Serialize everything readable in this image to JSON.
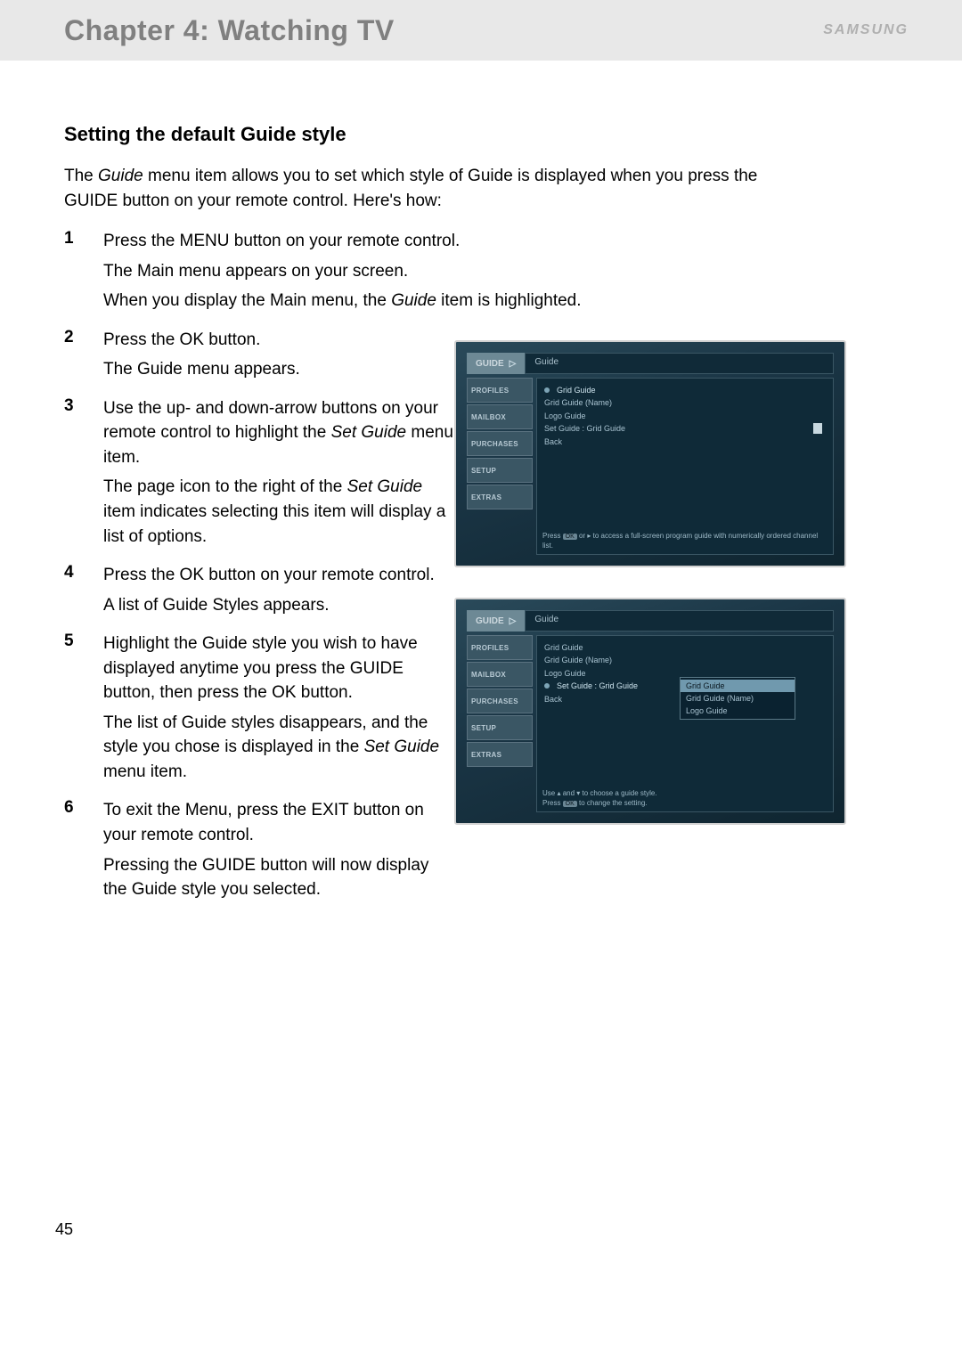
{
  "header": {
    "chapter_title": "Chapter 4: Watching TV",
    "brand": "SAMSUNG"
  },
  "section": {
    "title": "Setting the default Guide style",
    "intro_a": "The ",
    "intro_guide": "Guide",
    "intro_b": " menu item allows you to set which style of Guide is displayed when you press the GUIDE button on your remote control. Here's how:"
  },
  "steps": {
    "s1": {
      "num": "1",
      "p1": "Press the MENU button on your remote control.",
      "p2": "The Main menu appears on your screen.",
      "p3a": "When you display the Main menu, the ",
      "p3i": "Guide",
      "p3b": " item is highlighted."
    },
    "s2": {
      "num": "2",
      "p1": "Press the OK button.",
      "p2": "The Guide menu appears."
    },
    "s3": {
      "num": "3",
      "p1a": "Use the up- and down-arrow buttons on your remote control to highlight the ",
      "p1i": "Set Guide",
      "p1b": " menu item.",
      "p2a": "The page icon to the right of the ",
      "p2i": "Set Guide",
      "p2b": " item indicates selecting this item will display a list of options."
    },
    "s4": {
      "num": "4",
      "p1": "Press the OK button on your remote control.",
      "p2": "A list of Guide Styles appears."
    },
    "s5": {
      "num": "5",
      "p1": "Highlight the Guide style you wish to have displayed anytime you press the GUIDE button, then press the OK button.",
      "p2a": "The list of Guide styles disappears, and the style you chose is displayed in the ",
      "p2i": "Set Guide",
      "p2b": " menu item."
    },
    "s6": {
      "num": "6",
      "p1": "To exit the Menu, press the EXIT button on your remote control.",
      "p2": "Pressing the GUIDE button will now display the Guide style you selected."
    }
  },
  "tv": {
    "tab": "GUIDE",
    "header": "Guide",
    "side": [
      "PROFILES",
      "MAILBOX",
      "PURCHASES",
      "SETUP",
      "EXTRAS"
    ],
    "menu": {
      "l1": "Grid Guide",
      "l2": "Grid Guide (Name)",
      "l3": "Logo Guide",
      "l4": "Set Guide : Grid Guide",
      "l5": "Back"
    },
    "hint1a": "Press ",
    "hint1_ok": "OK",
    "hint1b": " or ▸ to access a full-screen program guide with numerically ordered channel list.",
    "popup": {
      "i1": "Grid Guide",
      "i2": "Grid Guide (Name)",
      "i3": "Logo Guide"
    },
    "hint2a": "Use ▴ and ▾ to choose a guide style.",
    "hint2b": "Press ",
    "hint2_ok": "OK",
    "hint2c": " to change the setting."
  },
  "page_number": "45"
}
